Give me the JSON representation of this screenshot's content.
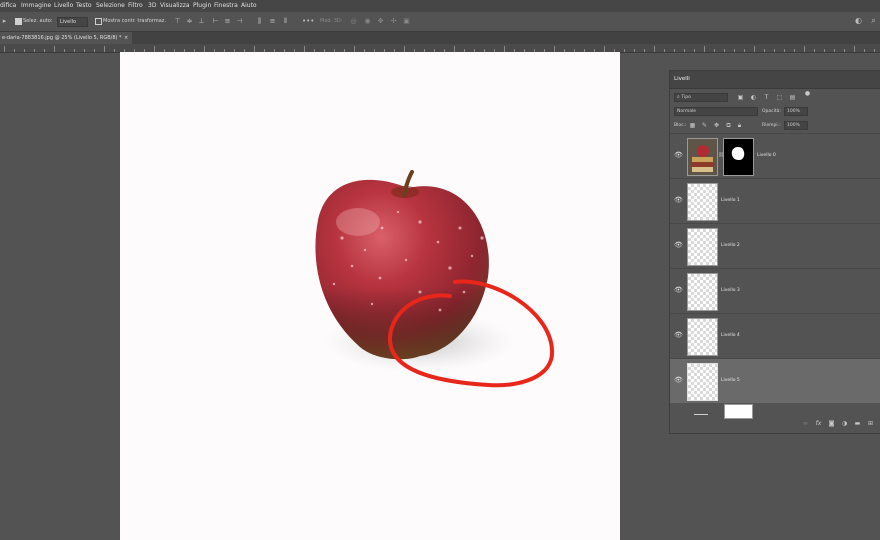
{
  "menubar": {
    "items": [
      "difica",
      "Immagine",
      "Livello",
      "Testo",
      "Selezione",
      "Filtro",
      "3D",
      "Visualizza",
      "Plugin",
      "Finestra",
      "Aiuto"
    ]
  },
  "options_bar": {
    "auto_select_label": "Selez. auto:",
    "auto_select_value": "Livello",
    "show_transform_label": "Mostra contr. trasformaz.",
    "mode_3d_label": "Mod. 3D:"
  },
  "document": {
    "tab_title": "e-daria-7883816.jpg @ 25% (Livello 5, RGB/8) *",
    "close_glyph": "×"
  },
  "layers_panel": {
    "title": "Livelli",
    "filter_kind": "Tipo",
    "blend_mode": "Normale",
    "opacity_label": "Opacità:",
    "opacity_value": "100%",
    "lock_label": "Bloc.:",
    "fill_label": "Riempi.:",
    "fill_value": "100%",
    "layers": [
      {
        "name": "Livello 0",
        "visible": true,
        "selected": false,
        "has_mask": true
      },
      {
        "name": "Livello 1",
        "visible": true,
        "selected": false,
        "has_mask": false
      },
      {
        "name": "Livello 2",
        "visible": true,
        "selected": false,
        "has_mask": false
      },
      {
        "name": "Livello 3",
        "visible": true,
        "selected": false,
        "has_mask": false
      },
      {
        "name": "Livello 4",
        "visible": true,
        "selected": false,
        "has_mask": false
      },
      {
        "name": "Livello 5",
        "visible": true,
        "selected": true,
        "has_mask": false
      }
    ],
    "footer_icons": [
      "link-icon",
      "fx-icon",
      "mask-icon",
      "adjustment-icon",
      "group-icon",
      "new-layer-icon",
      "trash-icon"
    ]
  },
  "colors": {
    "ui_background": "#535353",
    "menubar": "#464646",
    "canvas": "#fdfbfb",
    "annotation_circle": "#e8261a",
    "apple_red": "#a82a32"
  }
}
